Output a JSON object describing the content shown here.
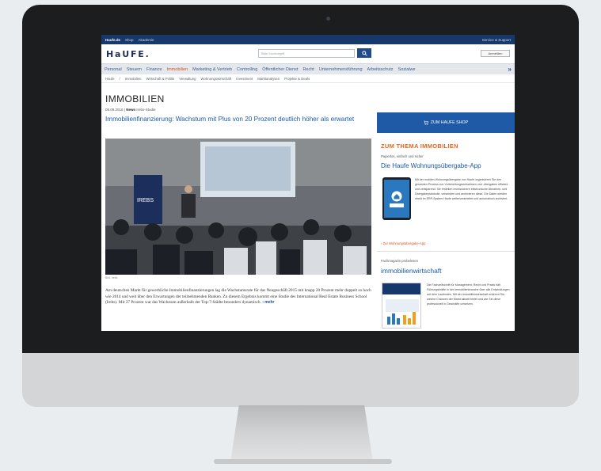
{
  "topbar": {
    "site": "Haufe.de",
    "links": [
      "Shop",
      "Akademie"
    ],
    "right_link": "Service & Support"
  },
  "brand": {
    "logo": "HaUFE."
  },
  "search": {
    "placeholder": "Bitte Suchbegriff",
    "icon": "search-icon"
  },
  "login": {
    "label": "Anmelden"
  },
  "nav": {
    "items": [
      "Personal",
      "Steuern",
      "Finance",
      "Immobilien",
      "Marketing & Vertrieb",
      "Controlling",
      "Öffentlicher Dienst",
      "Recht",
      "Unternehmensführung",
      "Arbeitsschutz",
      "Sozialwe"
    ],
    "active_index": 3,
    "more_label": "»"
  },
  "subnav": {
    "items": [
      "Haufe",
      "/",
      "Immobilien",
      "Wirtschaft & Politik",
      "Verwaltung",
      "Wohnungswirtschaft",
      "Investment",
      "Marktanalysen",
      "Projekte & Deals"
    ]
  },
  "article": {
    "section_title": "IMMOBILIEN",
    "date": "08.09.2016",
    "category": "News",
    "source": "Irebs-Studie",
    "headline": "Immobilienfinanzierung: Wachstum mit Plus von 20 Prozent deutlich höher als erwartet",
    "caption": "Bild: Irebs",
    "teaser": "Am deutschen Markt für gewerbliche Immobilienfinanzierungen lag die Wachstumsrate für das Neugeschäft 2015 mit knapp 20 Prozent mehr doppelt so hoch wie 2014 und weit über den Erwartungen der teilnehmenden Banken. Zu diesem Ergebnis kommt eine Studie des International Real Estate Business School (Irebs). Mit 37 Prozent war das Wachstum außerhalb der Top-7-Städte besonders dynamisch.",
    "more_label": "mehr",
    "photo_banner_text": "IREBS"
  },
  "sidebar": {
    "shop_button": "ZUM HAUFE SHOP",
    "heading": "ZUM THEMA IMMOBILIEN",
    "kicker": "Papierlos, einfach und sicher",
    "title": "Die Haufe Wohnungsübergabe-App",
    "text": "Mit der mobilen Wohnungsübergabe von Haufe organisieren Sie den gesamten Prozess von Vorbereitungsaufnahmen und -übergaben effizient und zeitsparend. Sie erstellen rechtssichere elektronische Abnahme- und Übergabeprotokolle, versenden und archivieren diese. Die Daten werden direkt im ERP-System Haufe weiterverarbeitet und automatisch archiviert.",
    "link": "Zur Wohnungsübergabe-App",
    "kicker2": "Fachmagazin probelesen",
    "title2": "immobilienwirtschaft",
    "text2": "Die Fachzeitschrift für Management, Recht und Praxis hält Führungskräfte in der Immobilienbranche über alle Entwicklungen auf dem Laufenden. Mit der immobilienwirtschaft erfahren Sie, welche Chancen der Markt aktuell bietet und wie Sie diese professionell in Geschäfte umsetzen."
  },
  "colors": {
    "navy": "#17386b",
    "accent": "#d9531e",
    "link": "#1a5aa6"
  }
}
